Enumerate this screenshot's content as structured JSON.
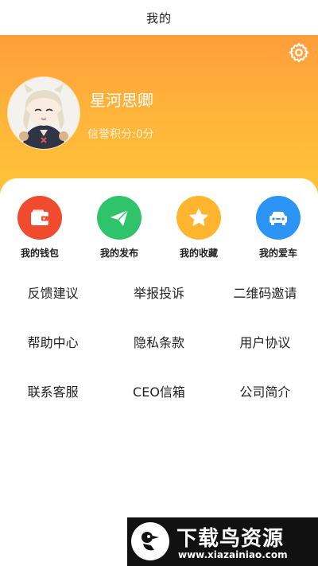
{
  "topbar": {
    "title": "我的"
  },
  "profile": {
    "username": "星河思卿",
    "credit": "信誉积分:0分"
  },
  "quick_actions": [
    {
      "label": "我的钱包",
      "icon": "wallet-icon",
      "color": "#f04a2f"
    },
    {
      "label": "我的发布",
      "icon": "paper-plane-icon",
      "color": "#2fc46b"
    },
    {
      "label": "我的收藏",
      "icon": "star-icon",
      "color": "#ffb52e"
    },
    {
      "label": "我的爱车",
      "icon": "car-icon",
      "color": "#2b94f5"
    }
  ],
  "menu": [
    [
      "反馈建议",
      "举报投诉",
      "二维码邀请"
    ],
    [
      "帮助中心",
      "隐私条款",
      "用户协议"
    ],
    [
      "联系客服",
      "CEO信箱",
      "公司简介"
    ]
  ],
  "watermark": {
    "title": "下载鸟资源",
    "url": "www.xiazainiao.com"
  },
  "colors": {
    "header_top": "#ff9d3c",
    "header_bottom": "#ffc43a"
  }
}
